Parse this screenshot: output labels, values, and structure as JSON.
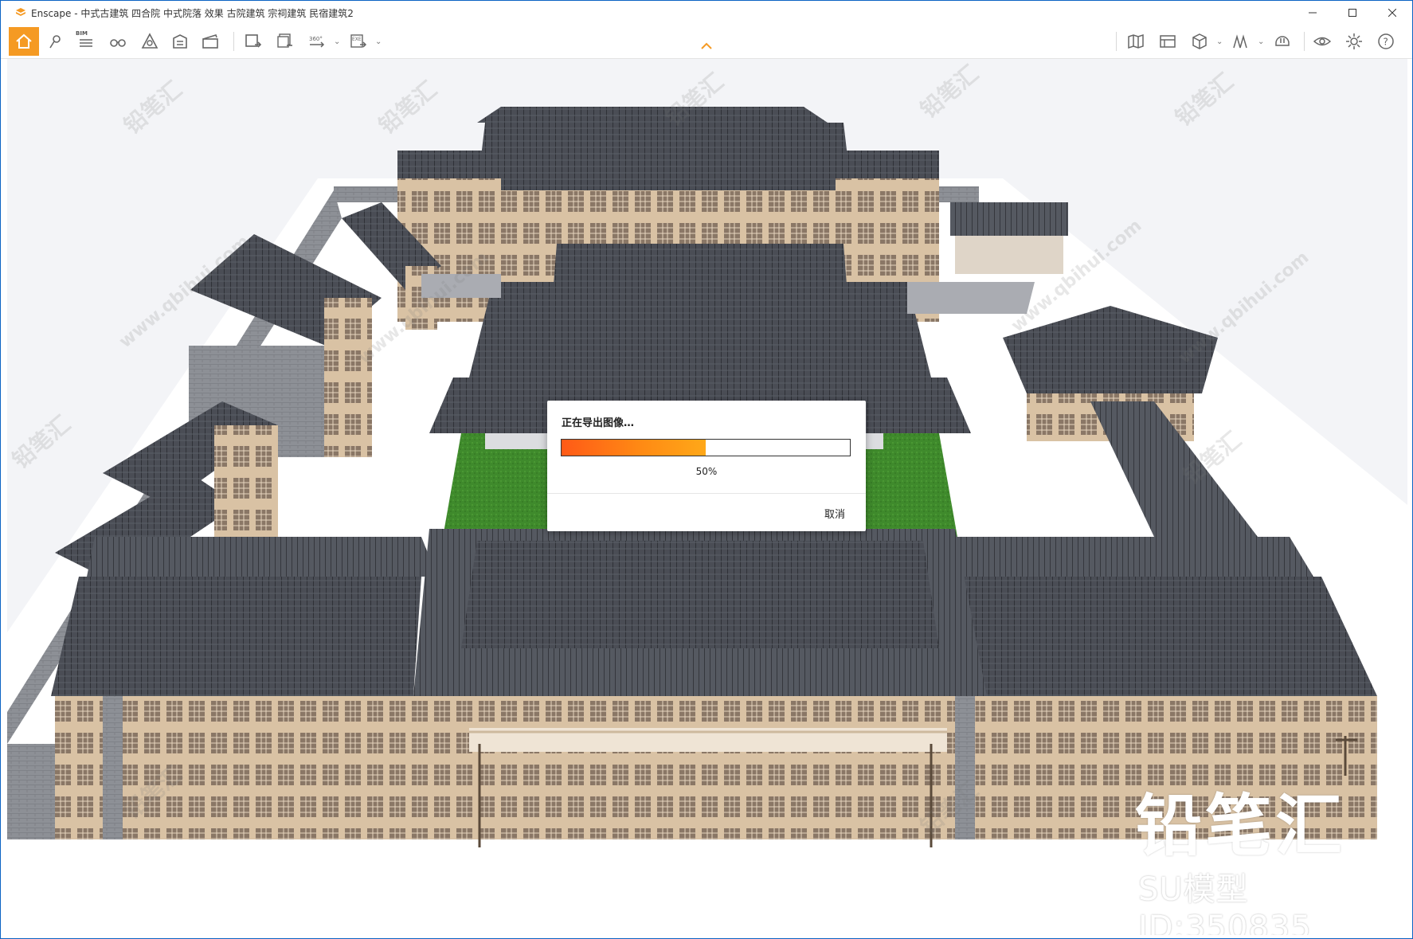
{
  "window": {
    "app_name": "Enscape",
    "title": "Enscape - 中式古建筑 四合院 中式院落 效果 古院建筑 宗祠建筑 民宿建筑2"
  },
  "toolbar": {
    "bim_label": "BIM",
    "accent": "#f59a23",
    "left_icons": [
      "home-icon",
      "location-pin-icon",
      "bim-list-icon",
      "binoculars-icon",
      "atmosphere-icon",
      "assets-icon",
      "clapper-icon"
    ],
    "export_icons": [
      "screenshot-export-icon",
      "batch-export-icon",
      "panorama-export-icon",
      "exe-export-icon"
    ],
    "right_icons": [
      "map-icon",
      "views-icon",
      "cube-icon",
      "sun-icon",
      "helmet-icon",
      "eye-icon",
      "gear-icon",
      "help-icon"
    ]
  },
  "viewport": {
    "brand_mark": "铅笔汇",
    "model_id": "SU模型ID:350835",
    "watermark_text": "铅笔汇",
    "watermark_url": "www.qbihui.com"
  },
  "dialog": {
    "title": "正在导出图像…",
    "progress": 0.5,
    "progress_label": "50%",
    "cancel_label": "取消"
  }
}
